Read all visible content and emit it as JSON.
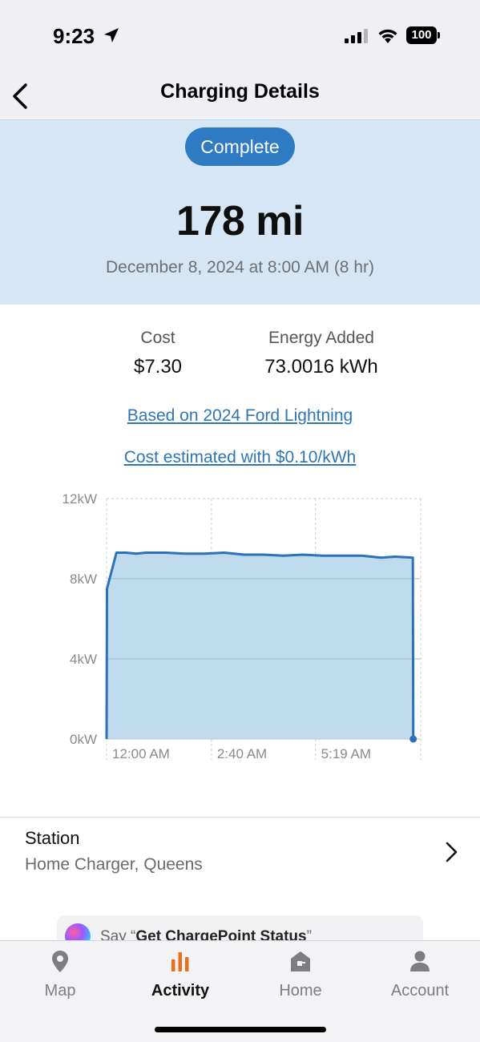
{
  "status_bar": {
    "time": "9:23",
    "battery": "100"
  },
  "nav": {
    "title": "Charging Details"
  },
  "session": {
    "status": "Complete",
    "miles": "178 mi",
    "date": "December 8, 2024 at 8:00 AM (8 hr)"
  },
  "stats": {
    "cost_label": "Cost",
    "cost_value": "$7.30",
    "energy_label": "Energy Added",
    "energy_value": "73.0016 kWh"
  },
  "links": {
    "vehicle": "Based on 2024 Ford Lightning",
    "rate": "Cost estimated with $0.10/kWh"
  },
  "colors": {
    "accent": "#2e7bc4",
    "hero_bg": "#d6e6f4",
    "line": "#2b72b6",
    "fill": "#bcd7ec",
    "active_tab_icon": "#e8701a"
  },
  "chart_data": {
    "type": "area",
    "y_ticks": [
      "0kW",
      "4kW",
      "8kW",
      "12kW"
    ],
    "x_ticks": [
      "12:00 AM",
      "2:40 AM",
      "5:19 AM"
    ],
    "ylim": [
      0,
      12
    ],
    "xlim_hours": [
      0,
      8
    ],
    "x_tick_hours": [
      0,
      2.67,
      5.32
    ],
    "grid": true,
    "series": [
      {
        "x": [
          0,
          0.01,
          0.25,
          0.5,
          0.75,
          1.0,
          1.5,
          2.0,
          2.5,
          3.0,
          3.5,
          4.0,
          4.5,
          5.0,
          5.5,
          6.0,
          6.5,
          7.0,
          7.35,
          7.8,
          7.81
        ],
        "y": [
          0,
          7.5,
          9.3,
          9.3,
          9.25,
          9.3,
          9.3,
          9.25,
          9.25,
          9.3,
          9.2,
          9.2,
          9.15,
          9.2,
          9.15,
          9.15,
          9.15,
          9.05,
          9.1,
          9.05,
          0
        ]
      }
    ]
  },
  "station": {
    "label": "Station",
    "name": "Home Charger, Queens"
  },
  "siri": {
    "prefix": "Say “",
    "phrase": "Get ChargePoint Status",
    "suffix": "”"
  },
  "tabs": [
    {
      "label": "Map",
      "icon": "map-pin-icon"
    },
    {
      "label": "Activity",
      "icon": "bar-chart-icon"
    },
    {
      "label": "Home",
      "icon": "home-charger-icon"
    },
    {
      "label": "Account",
      "icon": "person-icon"
    }
  ]
}
